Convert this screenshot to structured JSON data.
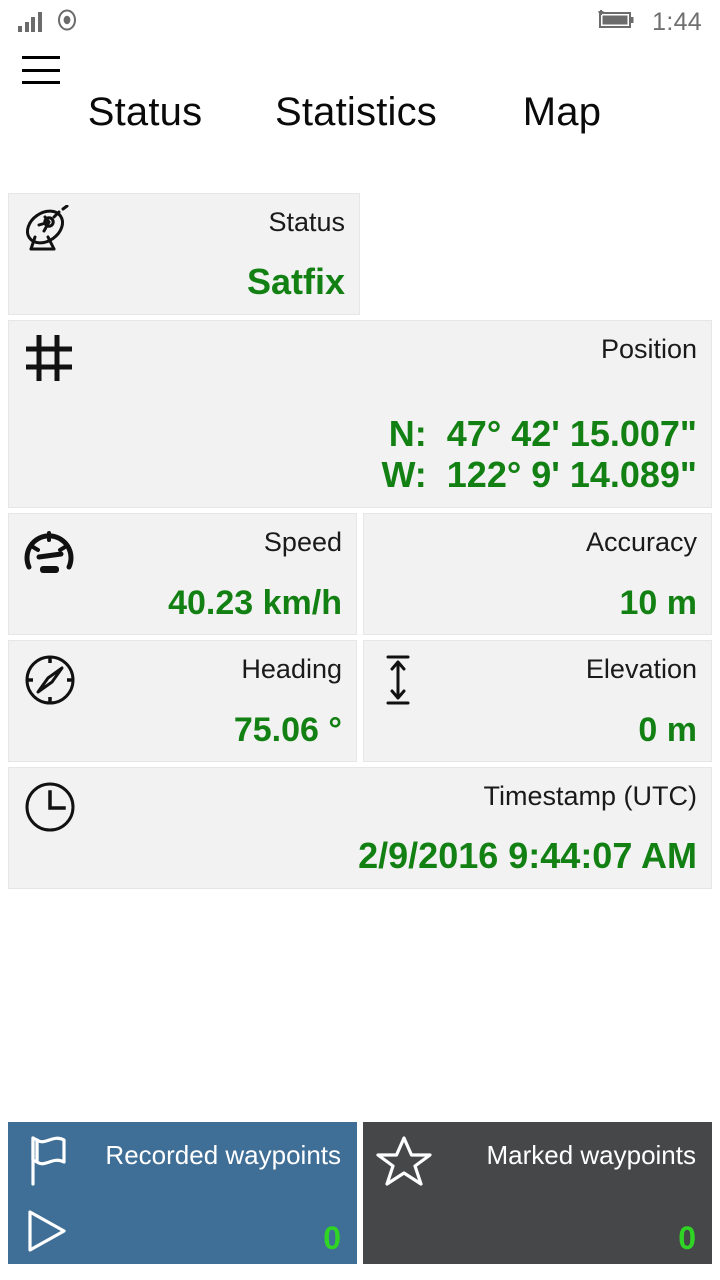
{
  "statusbar": {
    "signal_icon": "signal-bars-icon",
    "record_icon": "record-circle-icon",
    "battery_icon": "battery-charging-icon",
    "time": "1:44"
  },
  "header": {
    "menu_icon": "hamburger-menu-icon",
    "tabs": [
      {
        "label": "Status"
      },
      {
        "label": "Statistics"
      },
      {
        "label": "Map"
      }
    ]
  },
  "cards": {
    "status": {
      "icon": "satellite-dish-icon",
      "label": "Status",
      "value": "Satfix"
    },
    "position": {
      "icon": "grid-crosshatch-icon",
      "label": "Position",
      "lat": "N:  47° 42' 15.007\"",
      "lon": "W:  122° 9' 14.089\""
    },
    "speed": {
      "icon": "speedometer-icon",
      "label": "Speed",
      "value": "40.23 km/h"
    },
    "accuracy": {
      "icon": "",
      "label": "Accuracy",
      "value": "10 m"
    },
    "heading": {
      "icon": "compass-icon",
      "label": "Heading",
      "value": "75.06 °"
    },
    "elevation": {
      "icon": "vertical-arrow-icon",
      "label": "Elevation",
      "value": "0 m"
    },
    "timestamp": {
      "icon": "clock-icon",
      "label": "Timestamp (UTC)",
      "value": "2/9/2016 9:44:07 AM"
    }
  },
  "tiles": {
    "recorded": {
      "icon": "flag-icon",
      "sub_icon": "play-triangle-icon",
      "label": "Recorded waypoints",
      "count": "0",
      "color": "#3f6e96"
    },
    "marked": {
      "icon": "star-icon",
      "label": "Marked waypoints",
      "count": "0",
      "color": "#454749"
    }
  },
  "colors": {
    "value_green": "#128012",
    "count_green": "#2fd424",
    "card_bg": "#f2f2f2"
  }
}
